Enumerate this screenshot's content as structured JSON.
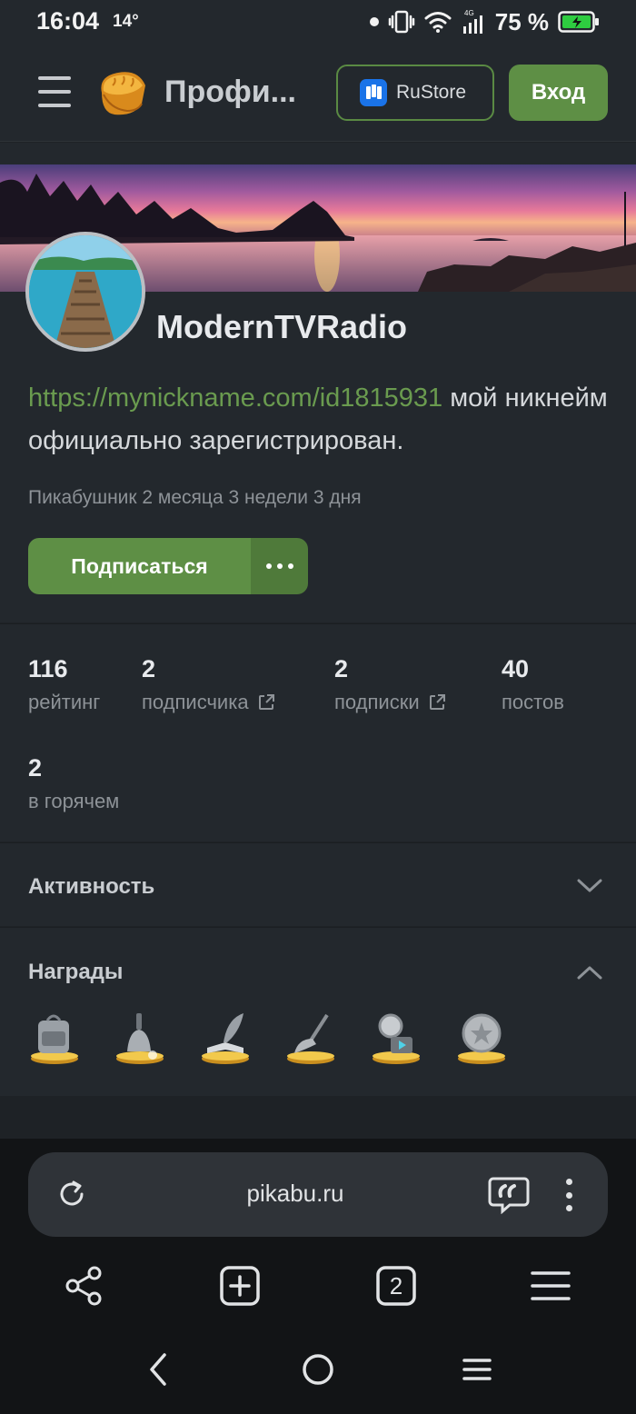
{
  "status_bar": {
    "time": "16:04",
    "temperature": "14°",
    "battery": "75 %",
    "network": "4G"
  },
  "header": {
    "title": "Профи...",
    "rustore_label": "RuStore",
    "login_label": "Вход"
  },
  "profile": {
    "username": "ModernTVRadio",
    "bio_link": "https://mynickname.com/id1815931",
    "bio_text": " мой никнейм официально зарегистрирован.",
    "tenure": "Пикабушник 2 месяца 3 недели 3 дня",
    "subscribe_label": "Подписаться"
  },
  "stats": [
    {
      "value": "116",
      "label": "рейтинг"
    },
    {
      "value": "2",
      "label": "подписчика"
    },
    {
      "value": "2",
      "label": "подписки"
    },
    {
      "value": "40",
      "label": "постов"
    },
    {
      "value": "2",
      "label": "в горячем"
    }
  ],
  "sections": {
    "activity_title": "Активность",
    "awards_title": "Награды"
  },
  "awards": [
    "backpack",
    "bell",
    "quill-book",
    "broom",
    "magnifier-video",
    "star-coin"
  ],
  "browser": {
    "url": "pikabu.ru",
    "tabs_count": "2"
  },
  "colors": {
    "accent_green": "#5e8f45",
    "link_green": "#6a9b4f",
    "background": "#23282d"
  }
}
